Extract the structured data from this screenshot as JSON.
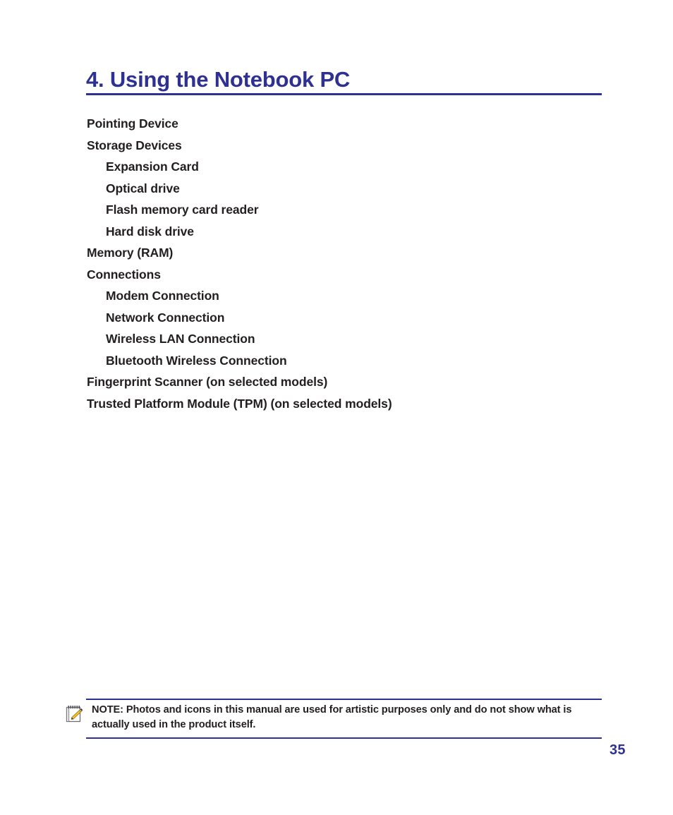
{
  "document": {
    "chapter_title": "4. Using the Notebook PC",
    "page_number": "35",
    "accent_color": "#2e3192",
    "text_color": "#231f20"
  },
  "toc": {
    "items": [
      {
        "label": "Pointing Device",
        "level": 1
      },
      {
        "label": "Storage Devices",
        "level": 1
      },
      {
        "label": "Expansion Card",
        "level": 2
      },
      {
        "label": "Optical drive",
        "level": 2
      },
      {
        "label": "Flash memory card reader",
        "level": 2
      },
      {
        "label": "Hard disk drive",
        "level": 2
      },
      {
        "label": "Memory (RAM)",
        "level": 1
      },
      {
        "label": "Connections",
        "level": 1
      },
      {
        "label": "Modem Connection",
        "level": 2
      },
      {
        "label": "Network Connection",
        "level": 2
      },
      {
        "label": "Wireless LAN Connection",
        "level": 2
      },
      {
        "label": "Bluetooth Wireless Connection",
        "level": 2
      },
      {
        "label": "Fingerprint Scanner (on selected models)",
        "level": 1
      },
      {
        "label": "Trusted Platform Module (TPM) (on selected models)",
        "level": 1
      }
    ]
  },
  "note": {
    "icon": "notepad-pencil-icon",
    "text": "NOTE: Photos and icons in this manual are used for artistic purposes only and do not show what is actually used in the product itself."
  }
}
